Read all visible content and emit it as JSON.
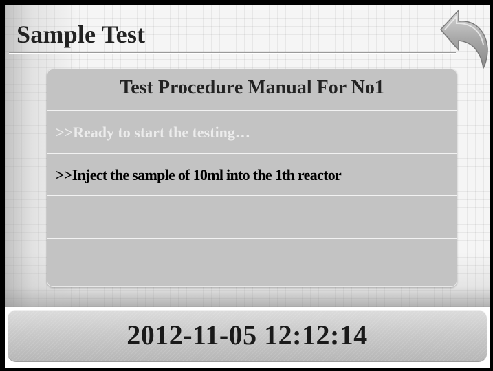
{
  "header": {
    "title": "Sample Test",
    "back_icon": "back-arrow-icon"
  },
  "panel": {
    "heading": "Test Procedure Manual For No1",
    "steps": [
      {
        "text": ">>Ready to start the testing…",
        "state": "done"
      },
      {
        "text": ">>Inject the sample of 10ml into the 1th reactor",
        "state": "active"
      },
      {
        "text": "",
        "state": "empty"
      },
      {
        "text": "",
        "state": "empty"
      }
    ]
  },
  "footer": {
    "datetime": "2012-11-05 12:12:14"
  },
  "colors": {
    "panel_bg": "#c3c3c3",
    "done_text": "#ececec",
    "active_text": "#000000"
  }
}
